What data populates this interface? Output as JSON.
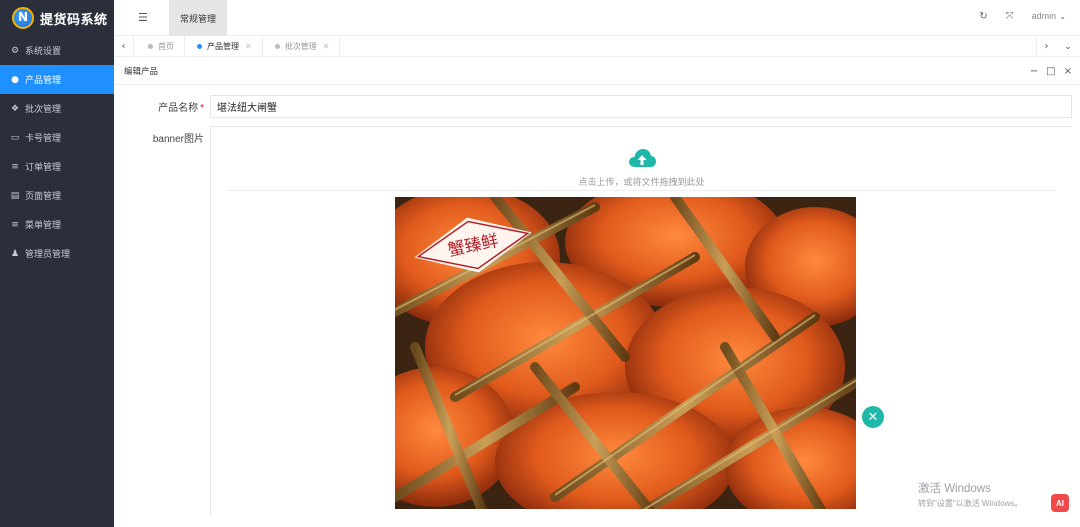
{
  "app": {
    "title": "提货码系统"
  },
  "sidebar": {
    "items": [
      {
        "label": "系统设置",
        "icon": "gears-icon",
        "active": false
      },
      {
        "label": "产品管理",
        "icon": "circle-icon",
        "active": true
      },
      {
        "label": "批次管理",
        "icon": "cubes-icon",
        "active": false
      },
      {
        "label": "卡号管理",
        "icon": "card-icon",
        "active": false
      },
      {
        "label": "订单管理",
        "icon": "list-icon",
        "active": false
      },
      {
        "label": "页面管理",
        "icon": "file-icon",
        "active": false
      },
      {
        "label": "菜单管理",
        "icon": "list-icon",
        "active": false
      },
      {
        "label": "管理员管理",
        "icon": "user-icon",
        "active": false
      }
    ]
  },
  "header": {
    "top_tab": "常规管理",
    "user": "admin"
  },
  "tabs": [
    {
      "label": "首页",
      "active": false,
      "closable": false
    },
    {
      "label": "产品管理",
      "active": true,
      "closable": true
    },
    {
      "label": "批次管理",
      "active": false,
      "closable": true
    }
  ],
  "panel": {
    "title": "编辑产品"
  },
  "form": {
    "name_label": "产品名称",
    "name_required_mark": "*",
    "name_value": "堪法纽大闸蟹",
    "banner_label": "banner图片",
    "upload_hint": "点击上传，或将文件拖拽到此处",
    "image_logo_text": "蟹臻鲜"
  },
  "watermark": {
    "line1": "激活 Windows",
    "line2": "转到\"设置\"以激活 Windows。"
  },
  "float_button": {
    "label": "AI"
  },
  "colors": {
    "sidebar_bg": "#2a2f3b",
    "active_blue": "#1e90ff",
    "upload_teal": "#1fb8a8"
  }
}
